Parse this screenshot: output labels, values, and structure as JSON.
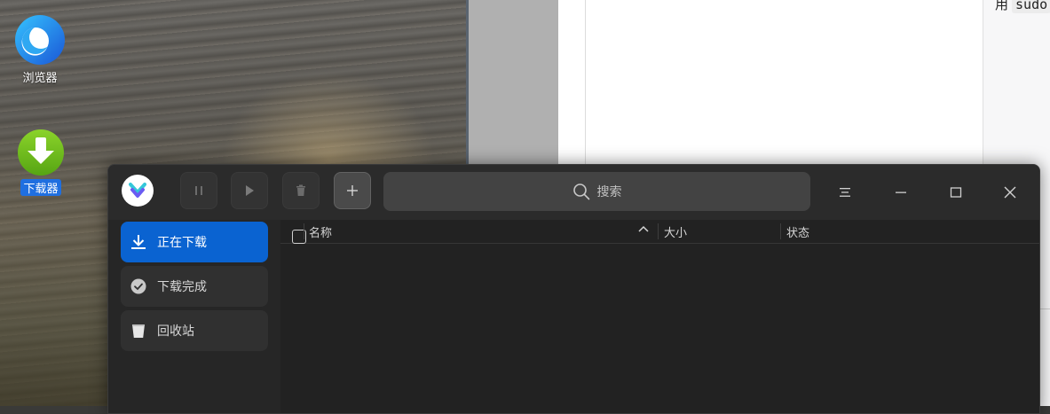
{
  "desktop": {
    "icons": [
      {
        "label": "浏览器",
        "icon": "browser-icon"
      },
      {
        "label": "下载器",
        "icon": "downloader-icon"
      }
    ]
  },
  "document": {
    "snippet_lead": "用",
    "snippet_code": "sudo"
  },
  "downloader": {
    "toolbar": {
      "pause_icon": "pause-icon",
      "start_icon": "play-icon",
      "delete_icon": "trash-icon",
      "add_icon": "plus-icon"
    },
    "search": {
      "placeholder": "搜索"
    },
    "window_controls": [
      "menu-icon",
      "minimize-icon",
      "maximize-icon",
      "close-icon"
    ],
    "sidebar": {
      "items": [
        {
          "label": "正在下载",
          "icon": "download-icon",
          "active": true
        },
        {
          "label": "下载完成",
          "icon": "check-circle-icon",
          "active": false
        },
        {
          "label": "回收站",
          "icon": "recycle-bin-icon",
          "active": false
        }
      ]
    },
    "table": {
      "columns": [
        "名称",
        "大小",
        "状态"
      ],
      "sort": "ascending"
    },
    "colors": {
      "accent": "#0a63d1",
      "window_bg": "#262626"
    }
  }
}
